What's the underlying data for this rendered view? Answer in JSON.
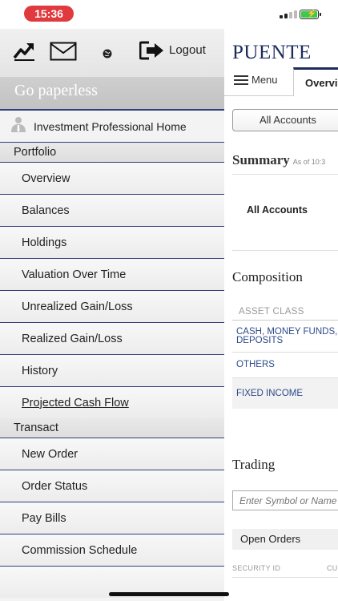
{
  "status_bar": {
    "time": "15:36",
    "time_pill_color": "#e0393e",
    "battery_color": "#3cc94a"
  },
  "drawer": {
    "icons": [
      "trend-chart-icon",
      "mail-icon",
      "globe-icon",
      "logout-icon"
    ],
    "logout_label": "Logout",
    "paperless_label": "Go paperless",
    "investment_home_label": "Investment Professional Home",
    "sections": [
      {
        "title": "Portfolio",
        "items": [
          "Overview",
          "Balances",
          "Holdings",
          "Valuation Over Time",
          "Unrealized Gain/Loss",
          "Realized Gain/Loss",
          "History",
          "Projected Cash Flow"
        ]
      },
      {
        "title": "Transact",
        "items": [
          "New Order",
          "Order Status",
          "Pay Bills",
          "Commission Schedule"
        ]
      }
    ],
    "accent_color": "#2d3f7a"
  },
  "main": {
    "brand": "PUENTE",
    "menu_label": "Menu",
    "active_tab": "Overview",
    "account_selector": "All Accounts",
    "summary_title": "Summary",
    "summary_asof": "As of 10:3",
    "summary_account_label": "All Accounts",
    "composition_title": "Composition",
    "composition_header": "ASSET CLASS",
    "composition_rows": [
      "CASH, MONEY FUNDS, DEPOSITS",
      "OTHERS",
      "FIXED INCOME"
    ],
    "trading_title": "Trading",
    "symbol_placeholder": "Enter Symbol or Name",
    "open_orders_title": "Open Orders",
    "open_orders_columns": [
      "SECURITY ID",
      "CU"
    ]
  }
}
